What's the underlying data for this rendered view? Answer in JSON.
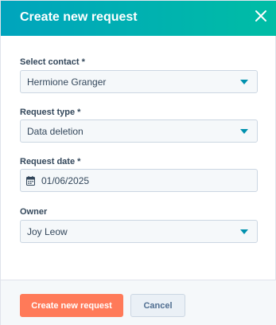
{
  "dialog": {
    "title": "Create new request",
    "close_icon": "close-icon"
  },
  "form": {
    "contact": {
      "label": "Select contact *",
      "value": "Hermione Granger",
      "icon": "chevron-down-icon"
    },
    "request_type": {
      "label": "Request type *",
      "value": "Data deletion",
      "icon": "chevron-down-icon"
    },
    "request_date": {
      "label": "Request date *",
      "value": "01/06/2025",
      "icon": "calendar-icon"
    },
    "owner": {
      "label": "Owner",
      "value": "Joy Leow",
      "icon": "chevron-down-icon"
    }
  },
  "footer": {
    "primary_label": "Create new request",
    "secondary_label": "Cancel"
  },
  "colors": {
    "header_gradient_start": "#00a4bd",
    "header_gradient_end": "#00bda5",
    "primary_button": "#ff7a59",
    "caret": "#0091ae",
    "text": "#33475b"
  }
}
